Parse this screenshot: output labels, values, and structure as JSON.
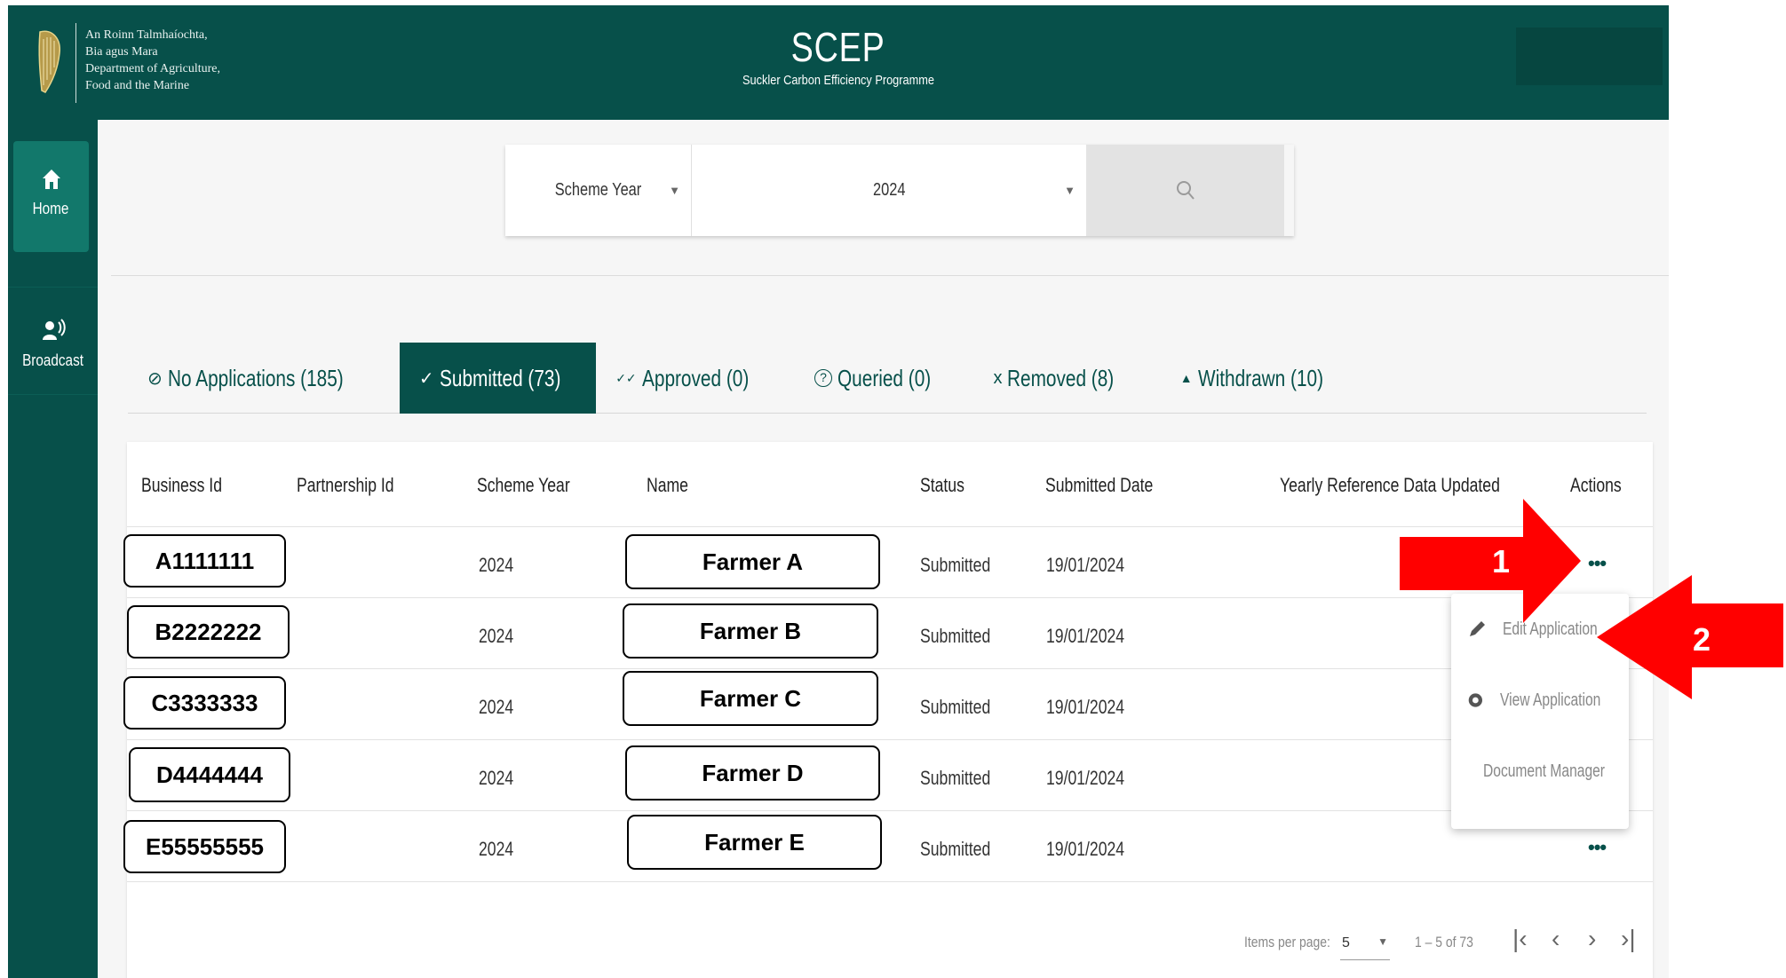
{
  "header": {
    "logo_lines": [
      "An Roinn Talmhaíochta,",
      "Bia agus Mara",
      "Department of Agriculture,",
      "Food and the Marine"
    ],
    "title": "SCEP",
    "subtitle": "Suckler Carbon Efficiency Programme"
  },
  "sidebar": {
    "items": [
      {
        "label": "Home",
        "icon": "home-icon",
        "active": true
      },
      {
        "label": "Broadcast",
        "icon": "broadcast-icon",
        "active": false
      }
    ]
  },
  "search": {
    "filter_label": "Scheme Year",
    "filter_value": "2024"
  },
  "tabs": [
    {
      "label": "No Applications (185)",
      "icon": "⊘"
    },
    {
      "label": "Submitted (73)",
      "icon": "✓",
      "active": true
    },
    {
      "label": "Approved (0)",
      "icon": "✓✓"
    },
    {
      "label": "Queried (0)",
      "icon": "?"
    },
    {
      "label": "Removed (8)",
      "icon": "x"
    },
    {
      "label": "Withdrawn (10)",
      "icon": "▲"
    }
  ],
  "table": {
    "columns": [
      "Business Id",
      "Partnership Id",
      "Scheme Year",
      "Name",
      "Status",
      "Submitted Date",
      "Yearly Reference Data Updated",
      "Actions"
    ],
    "rows": [
      {
        "business_id": "A1111111",
        "scheme_year": "2024",
        "name": "Farmer A",
        "status": "Submitted",
        "submitted_date": "19/01/2024"
      },
      {
        "business_id": "B2222222",
        "scheme_year": "2024",
        "name": "Farmer B",
        "status": "Submitted",
        "submitted_date": "19/01/2024"
      },
      {
        "business_id": "C3333333",
        "scheme_year": "2024",
        "name": "Farmer C",
        "status": "Submitted",
        "submitted_date": "19/01/2024"
      },
      {
        "business_id": "D4444444",
        "scheme_year": "2024",
        "name": "Farmer D",
        "status": "Submitted",
        "submitted_date": "19/01/2024"
      },
      {
        "business_id": "E55555555",
        "scheme_year": "2024",
        "name": "Farmer E",
        "status": "Submitted",
        "submitted_date": "19/01/2024"
      }
    ],
    "actions_glyph": "•••"
  },
  "paginator": {
    "items_per_page_label": "Items per page:",
    "items_per_page": "5",
    "range": "1 – 5 of 73"
  },
  "action_menu": {
    "items": [
      {
        "label": "Edit Application",
        "icon": "pencil-icon"
      },
      {
        "label": "View Application",
        "icon": "view-icon"
      },
      {
        "label": "Document Manager",
        "icon": "document-icon"
      }
    ]
  },
  "annotations": {
    "arrow1": "1",
    "arrow2": "2",
    "arrow_color": "#ff0000"
  },
  "colors": {
    "brand": "#07504a",
    "sidebar_active": "#12786b"
  }
}
